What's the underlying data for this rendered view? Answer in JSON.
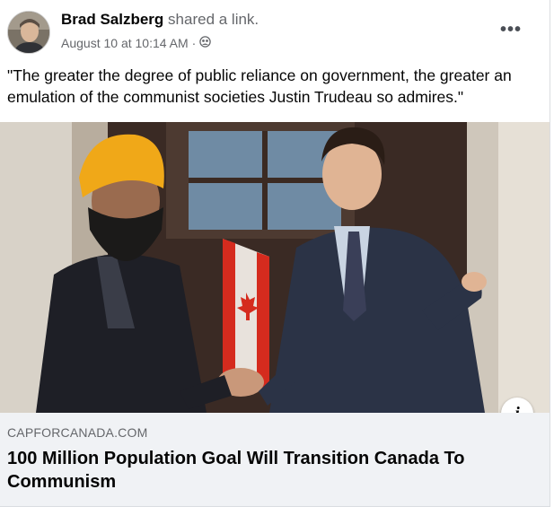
{
  "post": {
    "author": "Brad Salzberg",
    "action": "shared a link.",
    "timestamp": "August 10 at 10:14 AM",
    "separator": "·",
    "audience_icon": "friends-icon",
    "more_label": "•••",
    "text": "\"The greater the degree of public reliance on government, the greater an emulation of the communist societies Justin Trudeau so admires.\""
  },
  "link_preview": {
    "domain": "CAPFORCANADA.COM",
    "title": "100 Million Population Goal Will Transition Canada To Communism",
    "info_label": "i"
  },
  "colors": {
    "secondary_text": "#65676b",
    "card_background": "#f0f2f5",
    "flag_red": "#d52b1e",
    "turban": "#f0a818"
  }
}
